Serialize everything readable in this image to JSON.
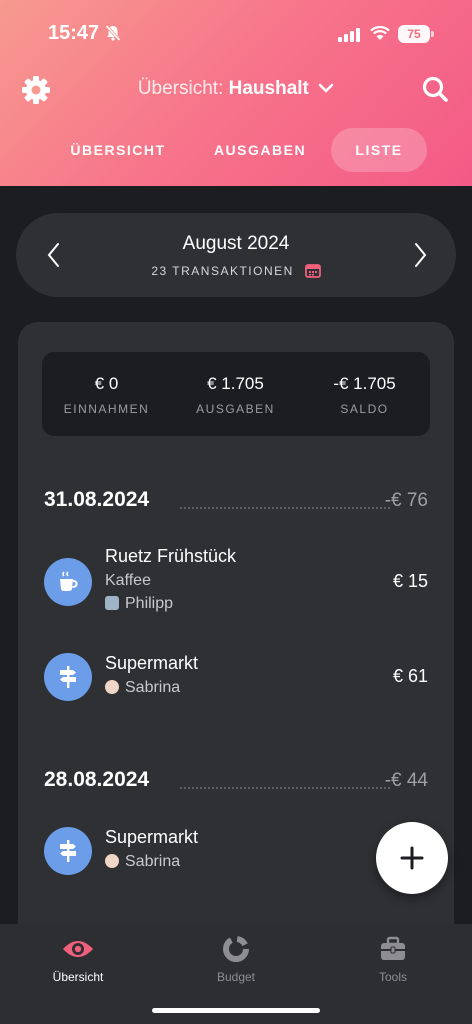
{
  "status": {
    "time": "15:47",
    "battery": "75"
  },
  "header": {
    "title_prefix": "Übersicht:",
    "title_group": "Haushalt",
    "tabs": [
      {
        "label": "ÜBERSICHT"
      },
      {
        "label": "AUSGABEN"
      },
      {
        "label": "LISTE"
      }
    ],
    "active_tab": "LISTE"
  },
  "month": {
    "title": "August 2024",
    "subtitle": "23 TRANSAKTIONEN"
  },
  "summary": {
    "income_value": "€ 0",
    "income_label": "EINNAHMEN",
    "expenses_value": "€ 1.705",
    "expenses_label": "AUSGABEN",
    "balance_value": "-€ 1.705",
    "balance_label": "SALDO"
  },
  "groups": [
    {
      "date": "31.08.2024",
      "total": "-€ 76",
      "transactions": [
        {
          "title": "Ruetz Frühstück",
          "category": "Kaffee",
          "user": "Philipp",
          "amount": "€ 15",
          "icon": "coffee-icon"
        },
        {
          "title": "Supermarkt",
          "category": "",
          "user": "Sabrina",
          "amount": "€ 61",
          "icon": "signpost-icon"
        }
      ]
    },
    {
      "date": "28.08.2024",
      "total": "-€ 44",
      "transactions": [
        {
          "title": "Supermarkt",
          "category": "",
          "user": "Sabrina",
          "amount": "",
          "icon": "signpost-icon"
        }
      ]
    }
  ],
  "bottom_nav": [
    {
      "label": "Übersicht",
      "icon": "eye-icon"
    },
    {
      "label": "Budget",
      "icon": "donut-chart-icon"
    },
    {
      "label": "Tools",
      "icon": "toolbox-icon"
    }
  ],
  "colors": {
    "header_gradient_start": "#f79a8f",
    "header_gradient_end": "#f35a86",
    "accent_pink": "#f0607c",
    "tx_icon_blue": "#6b9de8",
    "background": "#1c1d20",
    "card": "#2f3034"
  }
}
